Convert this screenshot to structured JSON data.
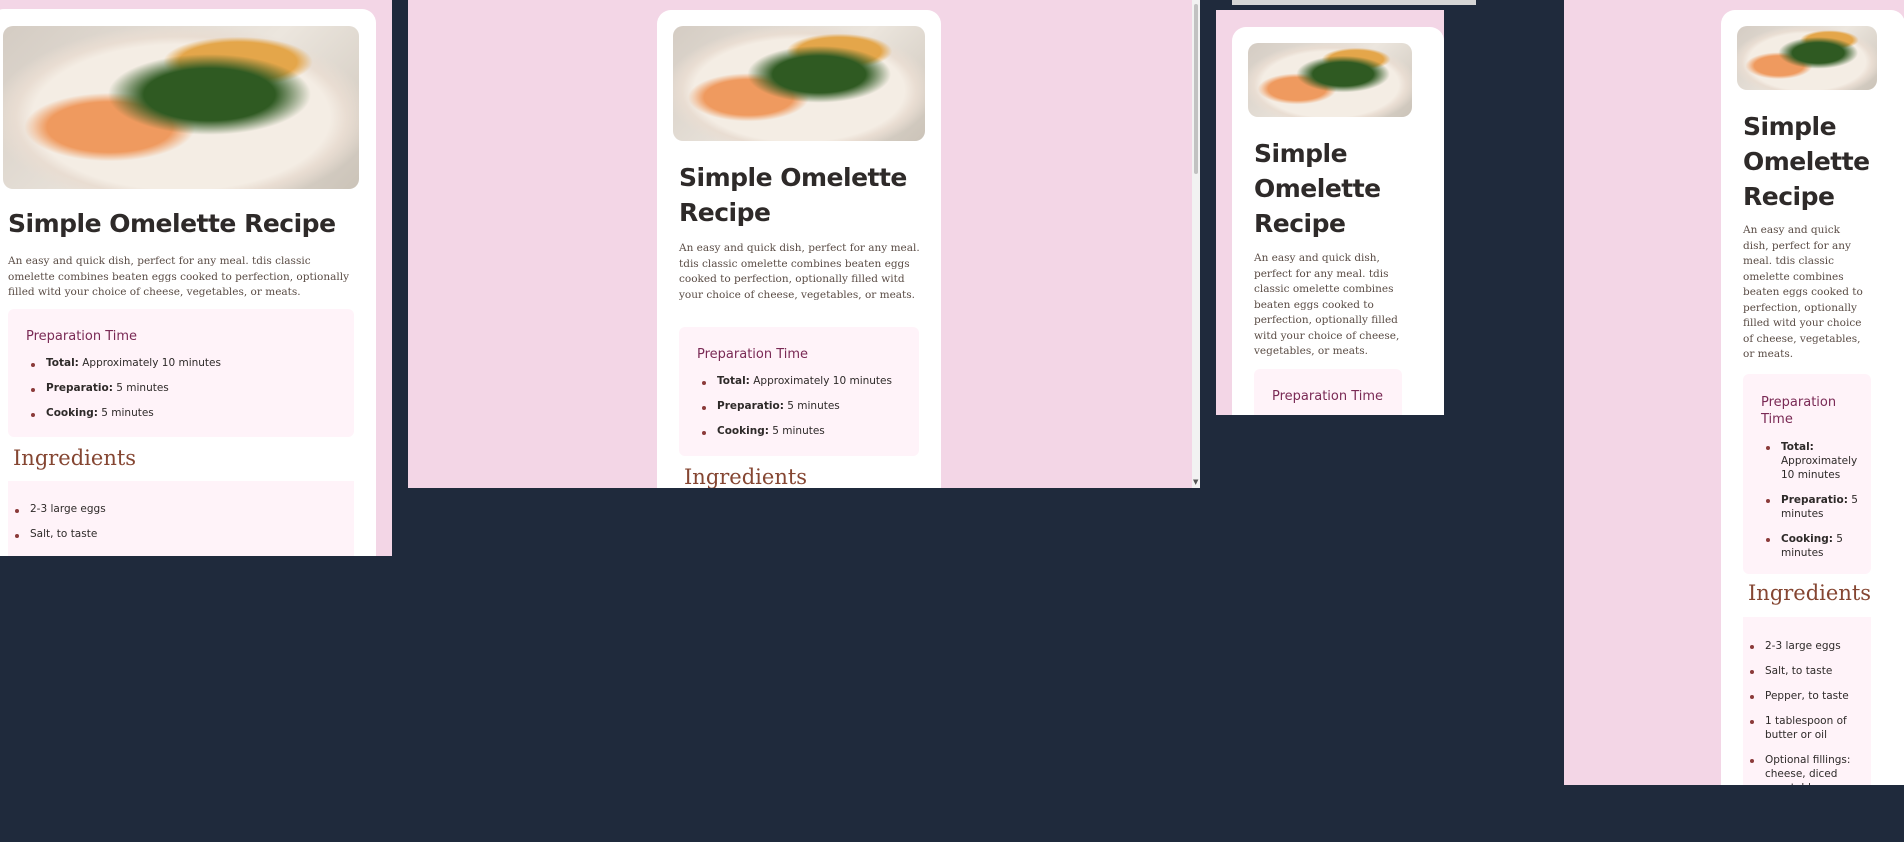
{
  "recipe": {
    "title": "Simple Omelette Recipe",
    "description": "An easy and quick dish, perfect for any meal. tdis classic omelette combines beaten eggs cooked to perfection, optionally filled witd your choice of cheese, vegetables, or meats.",
    "prep_heading": "Preparation Time",
    "prep_items": [
      {
        "label": "Total:",
        "value": "Approximately 10 minutes"
      },
      {
        "label": "Preparatio:",
        "value": "5 minutes"
      },
      {
        "label": "Cooking:",
        "value": "5 minutes"
      }
    ],
    "ingredients_heading": "Ingredients",
    "ingredients": [
      "2-3 large eggs",
      "Salt, to taste",
      "Pepper, to taste",
      "1 tablespoon of butter or oil",
      "Optional fillings: cheese, diced vegetables"
    ]
  },
  "colors": {
    "page_background": "#1f2a3c",
    "frame_background": "#f3d6e6",
    "card": "#ffffff",
    "panel": "#fff3f9",
    "prep_heading": "#7a2a55",
    "ingredients_heading": "#854632"
  },
  "images": {
    "dish_photo": "omelette-with-spinach-photo"
  }
}
